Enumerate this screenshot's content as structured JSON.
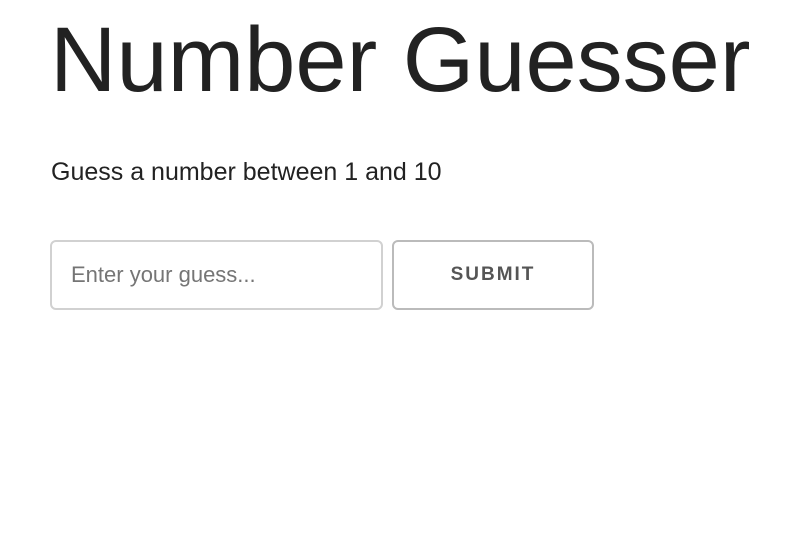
{
  "app": {
    "title": "Number Guesser",
    "instructions": "Guess a number between 1 and 10"
  },
  "form": {
    "guess_value": "",
    "guess_placeholder": "Enter your guess...",
    "submit_label": "SUBMIT"
  },
  "colors": {
    "text": "#222222",
    "button_text": "#555555",
    "border": "#bbbbbb",
    "background": "#ffffff"
  }
}
